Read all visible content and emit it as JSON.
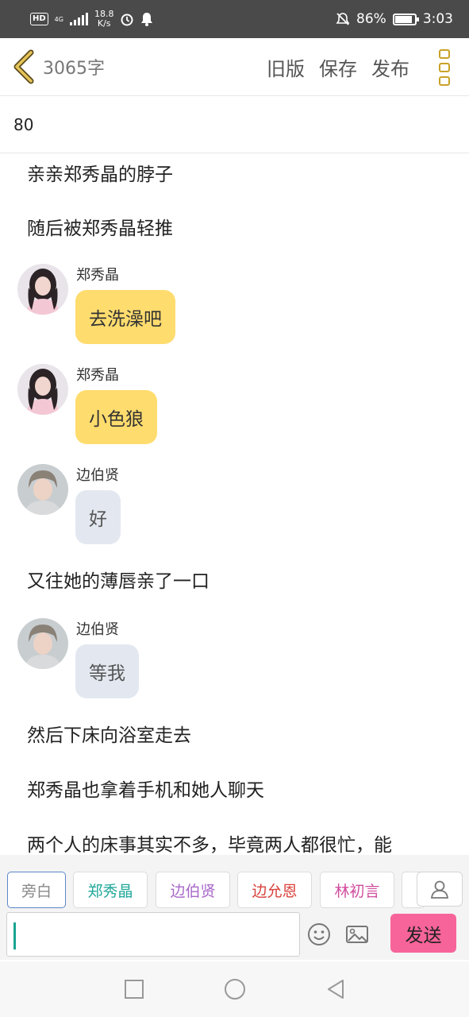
{
  "status_bar": {
    "hd": "HD",
    "network": "4G",
    "speed_value": "18.8",
    "speed_unit": "K/s",
    "battery_percent": "86%",
    "battery_level": 0.86,
    "time": "3:03"
  },
  "header": {
    "word_count": "3065字",
    "old_version": "旧版",
    "save": "保存",
    "publish": "发布",
    "accent_color": "#c9a227"
  },
  "chapter_title": "80",
  "content": {
    "line1": "亲亲郑秀晶的脖子",
    "line2": "随后被郑秀晶轻推",
    "msg1": {
      "name": "郑秀晶",
      "text": "去洗澡吧"
    },
    "msg2": {
      "name": "郑秀晶",
      "text": "小色狼"
    },
    "msg3": {
      "name": "边伯贤",
      "text": "好"
    },
    "line3": "又往她的薄唇亲了一口",
    "msg4": {
      "name": "边伯贤",
      "text": "等我"
    },
    "line4": "然后下床向浴室走去",
    "line5": "郑秀晶也拿着手机和她人聊天",
    "line6": "两个人的床事其实不多，毕竟两人都很忙，能"
  },
  "roles": [
    {
      "label": "旁白",
      "color": "#888888"
    },
    {
      "label": "郑秀晶",
      "color": "#21a89a"
    },
    {
      "label": "边伯贤",
      "color": "#a868c9"
    },
    {
      "label": "边允恩",
      "color": "#d8423c"
    },
    {
      "label": "林初言",
      "color": "#d04d9e"
    }
  ],
  "composer": {
    "send_label": "发送",
    "send_color": "#f7649a"
  }
}
